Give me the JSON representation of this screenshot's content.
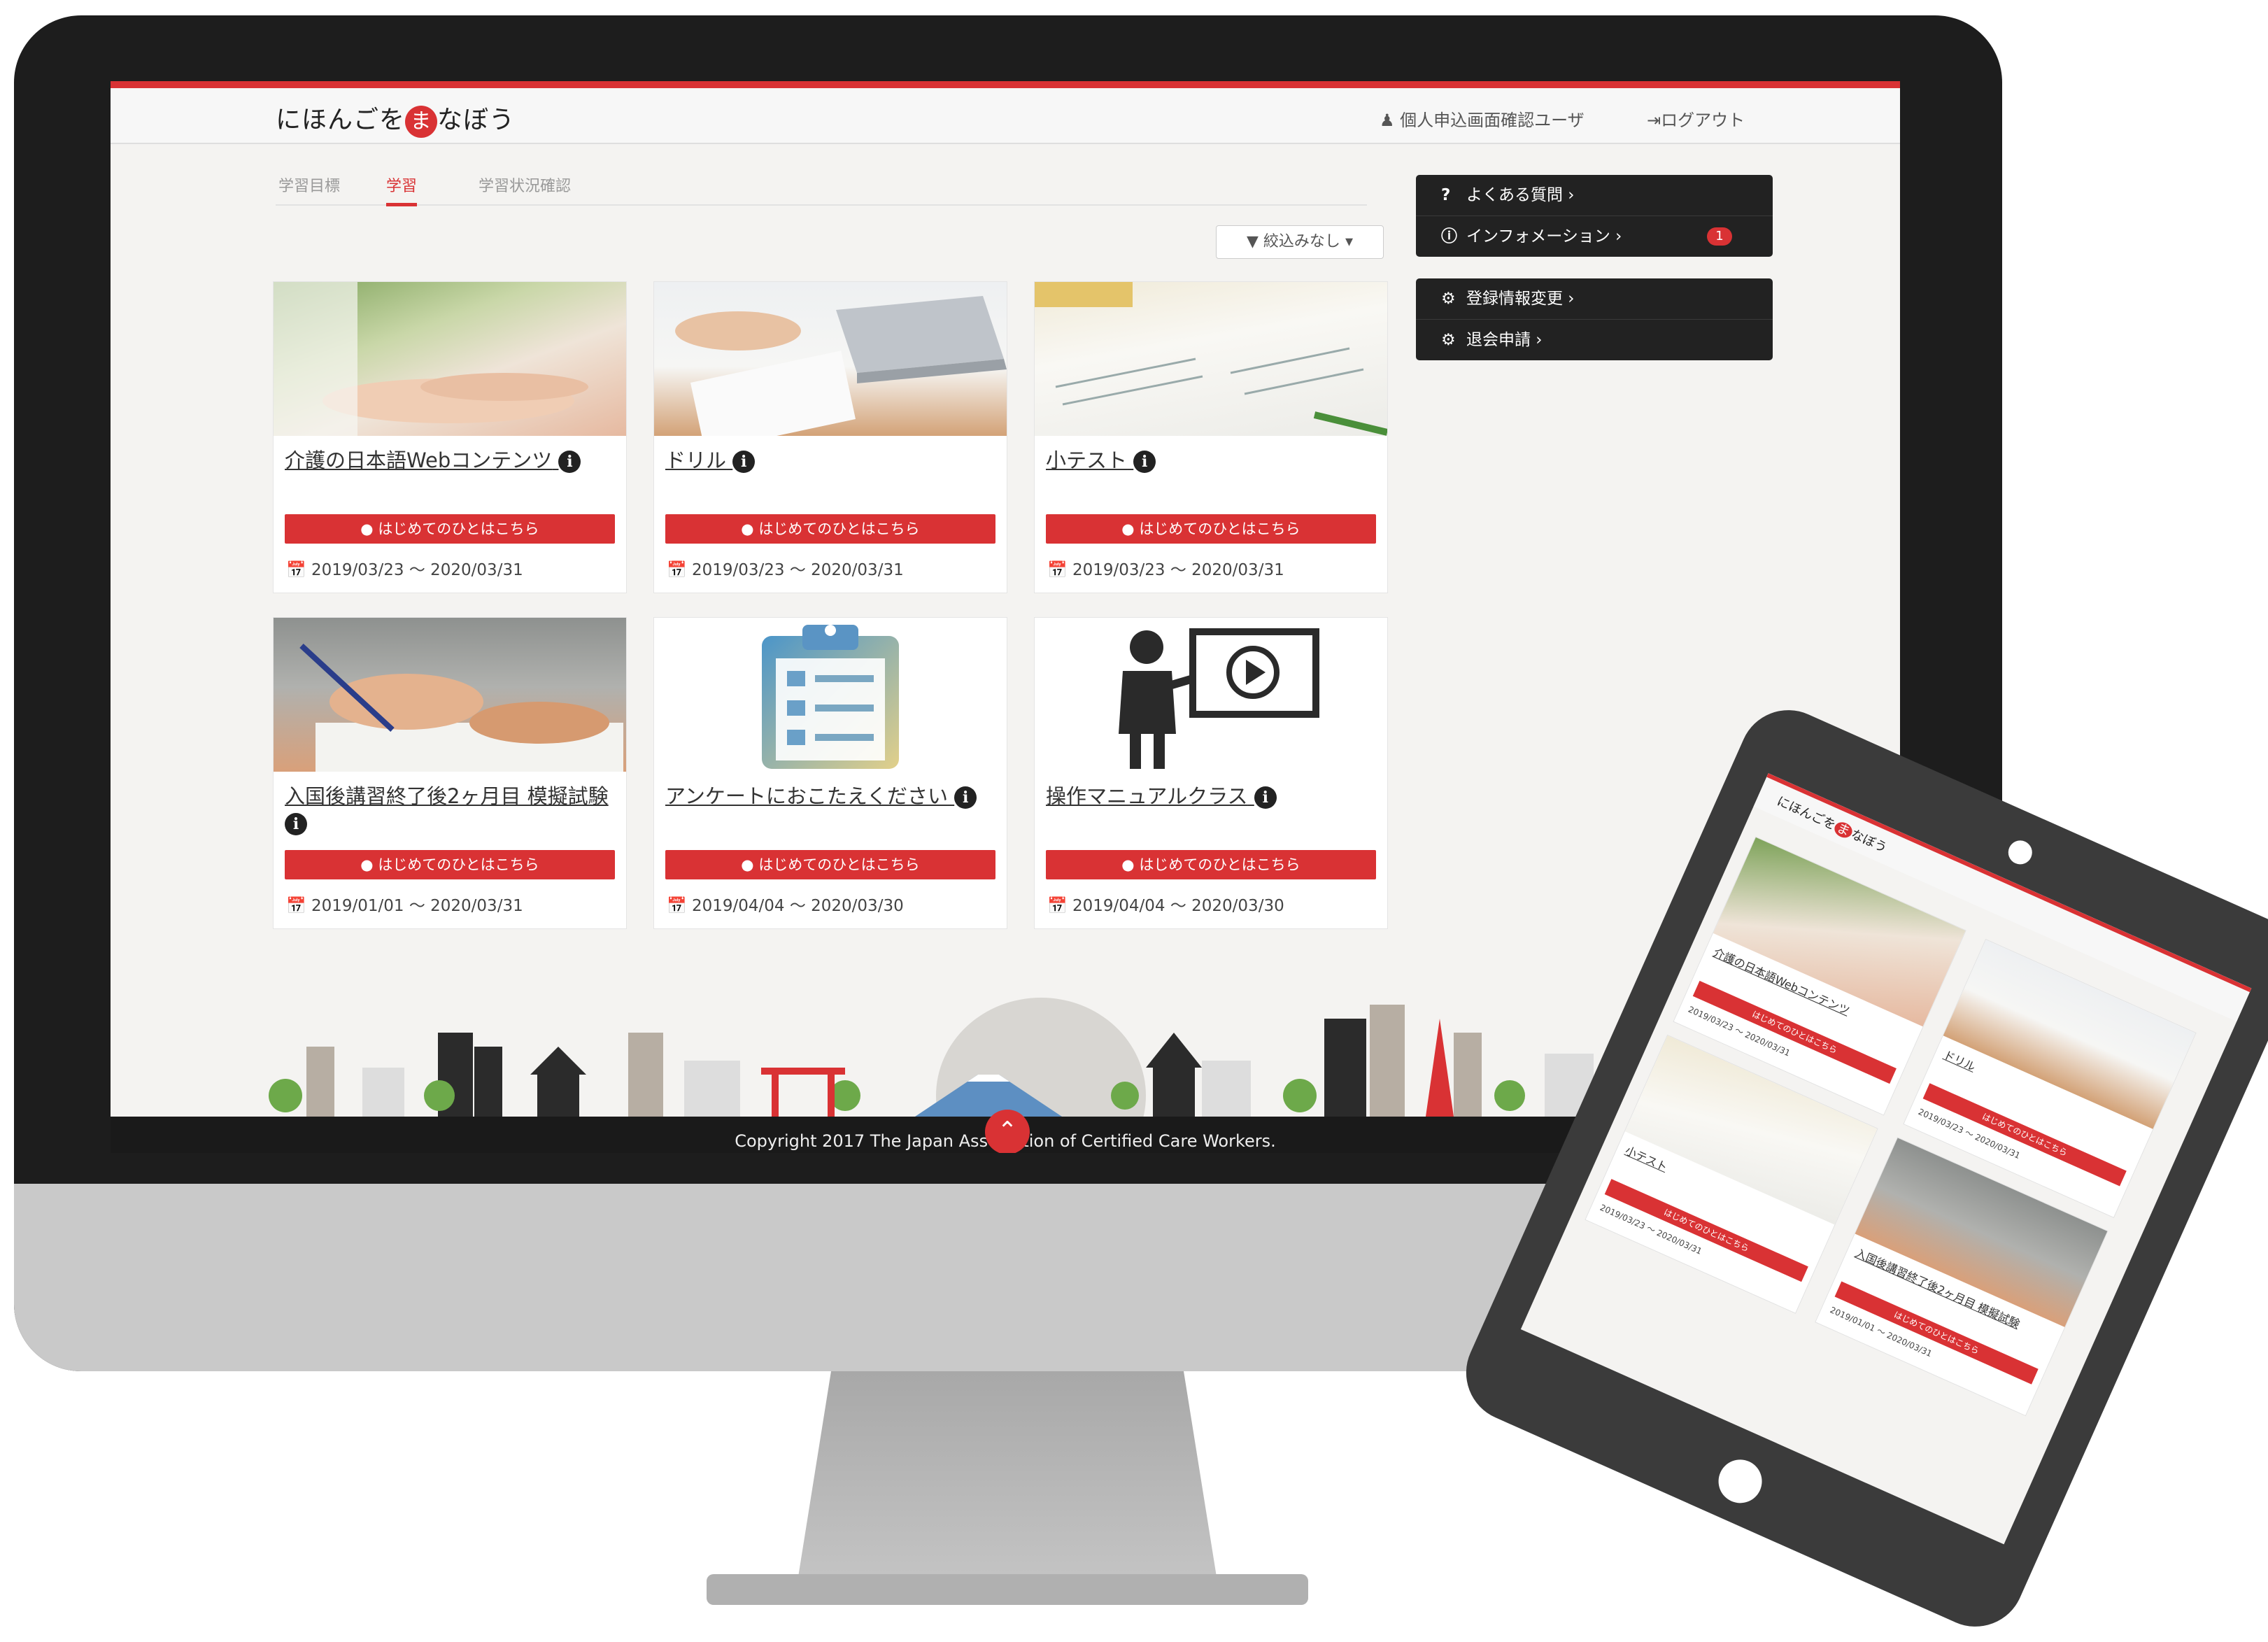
{
  "app": {
    "logo_pre": "にほんごを",
    "logo_mark": "ま",
    "logo_post": "なぼう",
    "user_label": "個人申込画面確認ユーザ",
    "logout_label": "ログアウト"
  },
  "tabs": [
    {
      "label": "学習目標"
    },
    {
      "label": "学習"
    },
    {
      "label": "学習状況確認"
    }
  ],
  "filter": {
    "label": "絞込みなし"
  },
  "menu": {
    "faq": "よくある質問",
    "info": "インフォメーション",
    "info_badge": "1",
    "profile": "登録情報変更",
    "withdraw": "退会申請"
  },
  "cards": [
    {
      "title": "介護の日本語Webコンテンツ",
      "button": "はじめてのひとはこちら",
      "date": "2019/03/23 ～ 2020/03/31",
      "image": "hands-photo"
    },
    {
      "title": "ドリル",
      "button": "はじめてのひとはこちら",
      "date": "2019/03/23 ～ 2020/03/31",
      "image": "laptop-photo"
    },
    {
      "title": "小テスト",
      "button": "はじめてのひとはこちら",
      "date": "2019/03/23 ～ 2020/03/31",
      "image": "papers-photo"
    },
    {
      "title": "入国後講習終了後2ヶ月目 模擬試験",
      "button": "はじめてのひとはこちら",
      "date": "2019/01/01 ～ 2020/03/31",
      "image": "writing-photo"
    },
    {
      "title": "アンケートにおこたえください",
      "button": "はじめてのひとはこちら",
      "date": "2019/04/04 ～ 2020/03/30",
      "image": "clipboard-icon"
    },
    {
      "title": "操作マニュアルクラス",
      "button": "はじめてのひとはこちら",
      "date": "2019/04/04 ～ 2020/03/30",
      "image": "presenter-icon"
    }
  ],
  "footer": {
    "copyright": "Copyright 2017 The Japan Association of Certified Care Workers."
  },
  "colors": {
    "accent": "#d93234",
    "menu_bg": "#222222",
    "page_bg": "#f4f3f1"
  }
}
